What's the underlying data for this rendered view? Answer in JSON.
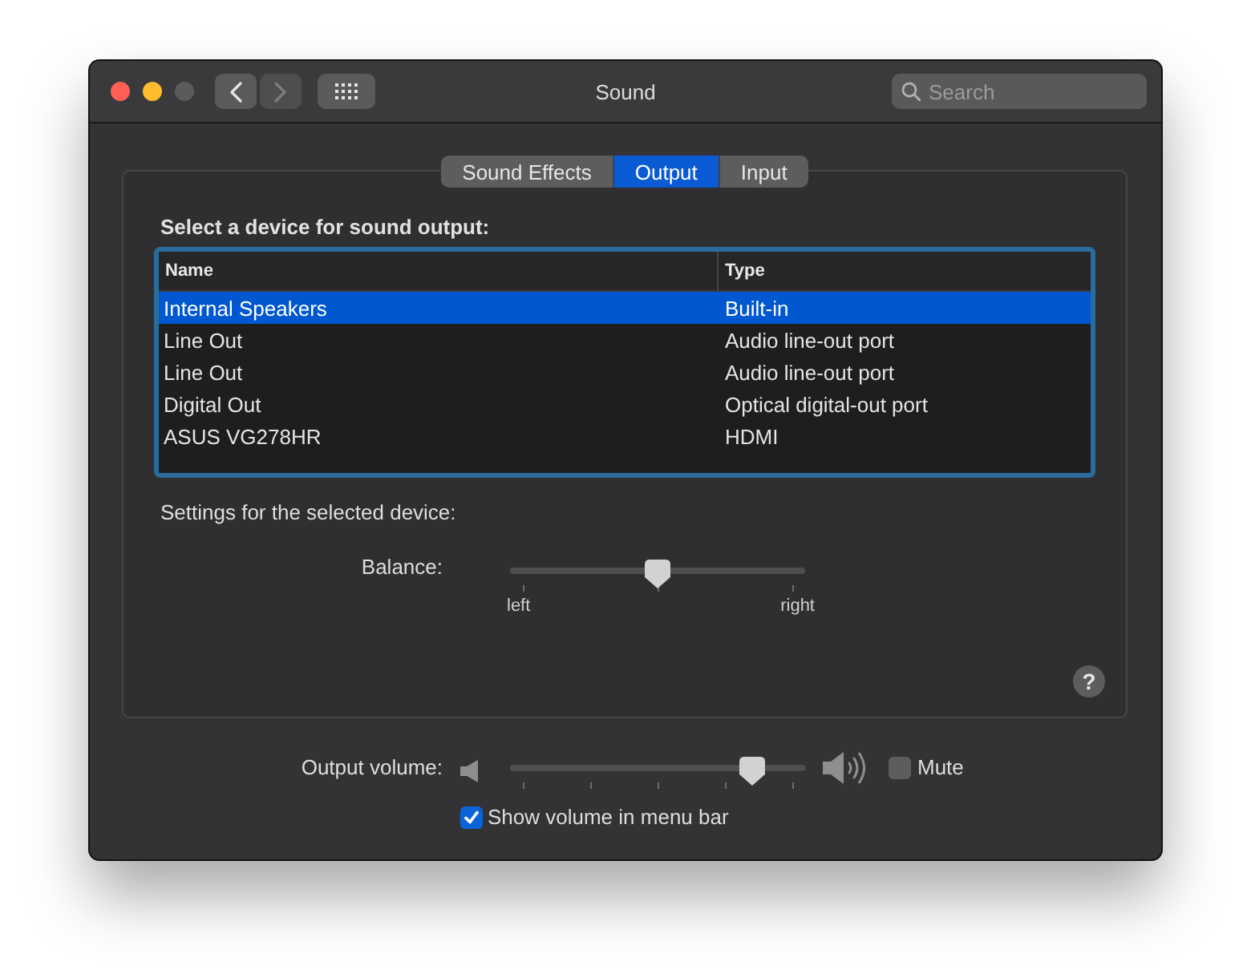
{
  "window": {
    "title": "Sound",
    "controls": [
      {
        "kind": "close",
        "disabled": false
      },
      {
        "kind": "minimize",
        "disabled": false
      },
      {
        "kind": "zoom",
        "disabled": true
      }
    ],
    "navigation": [
      {
        "kind": "back",
        "disabled": false
      },
      {
        "kind": "forward",
        "disabled": true
      }
    ],
    "search": {
      "placeholder": "Search"
    }
  },
  "tabs": [
    {
      "label": "Sound Effects",
      "selected": false
    },
    {
      "label": "Output",
      "selected": true
    },
    {
      "label": "Input",
      "selected": false
    }
  ],
  "output_panel": {
    "heading": "Select a device for sound output:",
    "table": {
      "columns": [
        "Name",
        "Type"
      ],
      "rows": [
        {
          "cells": [
            "Internal Speakers",
            "Built-in"
          ],
          "selected": true
        },
        {
          "cells": [
            "Line Out",
            "Audio line-out port"
          ],
          "selected": false
        },
        {
          "cells": [
            "Line Out",
            "Audio line-out port"
          ],
          "selected": false
        },
        {
          "cells": [
            "Digital Out",
            "Optical digital-out port"
          ],
          "selected": false
        },
        {
          "cells": [
            "ASUS VG278HR",
            "HDMI"
          ],
          "selected": false
        }
      ]
    },
    "settings_heading": "Settings for the selected device:",
    "balance": {
      "label": "Balance:",
      "level": 0.5,
      "min_label": "left",
      "max_label": "right"
    },
    "help": "?"
  },
  "volume": {
    "label": "Output volume:",
    "level": 0.85,
    "mute": {
      "label": "Mute",
      "checked": false
    }
  },
  "show_in_menu_bar": {
    "label": "Show volume in menu bar",
    "checked": true
  }
}
